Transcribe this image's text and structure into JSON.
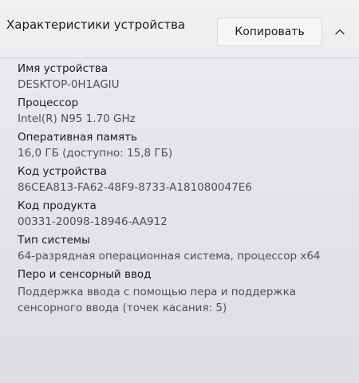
{
  "section": {
    "title": "Характеристики устройства",
    "copy_label": "Копировать",
    "collapse_icon": "chevron-up-icon"
  },
  "properties": [
    {
      "label": "Имя устройства",
      "value": "DESKTOP-0H1AGIU"
    },
    {
      "label": "Процессор",
      "value": "Intel(R) N95   1.70 GHz"
    },
    {
      "label": "Оперативная память",
      "value": "16,0 ГБ (доступно: 15,8 ГБ)"
    },
    {
      "label": "Код устройства",
      "value": "86CEA813-FA62-48F9-8733-A181080047E6"
    },
    {
      "label": "Код продукта",
      "value": "00331-20098-18946-AA912"
    },
    {
      "label": "Тип системы",
      "value": "64-разрядная операционная система, процессор x64"
    },
    {
      "label": "Перо и сенсорный ввод",
      "value": "Поддержка ввода с помощью пера и поддержка сенсорного ввода (точек касания: 5)"
    }
  ]
}
